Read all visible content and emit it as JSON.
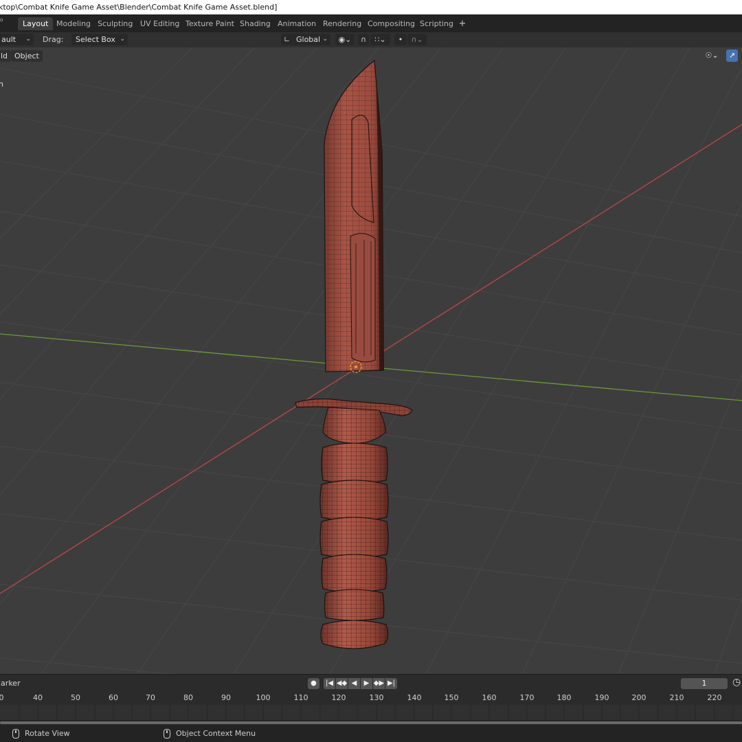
{
  "title_bar": {
    "text": "ktop\\Combat Knife Game Asset\\Blender\\Combat Knife Game Asset.blend]"
  },
  "workspaces": {
    "tabs": [
      "Layout",
      "Modeling",
      "Sculpting",
      "UV Editing",
      "Texture Paint",
      "Shading",
      "Animation",
      "Rendering",
      "Compositing",
      "Scripting"
    ],
    "active": "Layout",
    "add_label": "+"
  },
  "header": {
    "mode_dropdown": "ault",
    "drag_label": "Drag:",
    "drag_dropdown": "Select Box",
    "orientation_dropdown": "Global"
  },
  "viewport": {
    "menus": {
      "view": "ld",
      "object": "Object"
    },
    "left_edge_fragment": "n",
    "colors": {
      "background": "#3d3d3d",
      "grid": "#4a4a4a",
      "x_axis": "#c0454c",
      "y_axis": "#6b9a37",
      "mesh_fill": "#a04f44",
      "mesh_wire": "#1e1210",
      "origin_marker": "#f0a030"
    },
    "object": "combat-knife-mesh"
  },
  "timeline": {
    "marker_label": "larker",
    "current_frame": "1",
    "ruler_ticks": [
      "0",
      "40",
      "50",
      "60",
      "70",
      "80",
      "90",
      "100",
      "110",
      "120",
      "130",
      "140",
      "150",
      "160",
      "170",
      "180",
      "190",
      "200",
      "210",
      "220"
    ]
  },
  "status_bar": {
    "rotate_view": "Rotate View",
    "object_context_menu": "Object Context Menu"
  }
}
